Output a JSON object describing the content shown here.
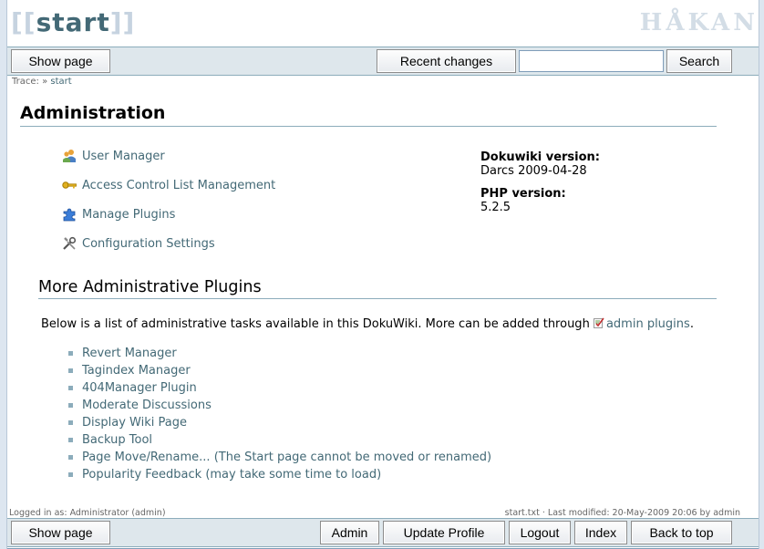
{
  "header": {
    "brand_open": "[[",
    "brand_word": "start",
    "brand_close": "]]",
    "logo": "HÅKAN"
  },
  "top_bar": {
    "show_page": "Show page",
    "recent_changes": "Recent changes",
    "search_value": "",
    "search": "Search"
  },
  "trace": {
    "label": "Trace:",
    "sep": "»",
    "current": "start"
  },
  "main": {
    "title": "Administration",
    "admin_items": [
      {
        "label": "User Manager",
        "icon": "users-icon"
      },
      {
        "label": "Access Control List Management",
        "icon": "key-icon"
      },
      {
        "label": "Manage Plugins",
        "icon": "puzzle-icon"
      },
      {
        "label": "Configuration Settings",
        "icon": "tools-icon"
      }
    ],
    "dokuwiki_version_label": "Dokuwiki version:",
    "dokuwiki_version": "Darcs 2009-04-28",
    "php_version_label": "PHP version:",
    "php_version": "5.2.5",
    "more_title": "More Administrative Plugins",
    "intro_text": "Below is a list of administrative tasks available in this DokuWiki. More can be added through",
    "intro_link": "admin plugins",
    "intro_end": ".",
    "plugins": [
      "Revert Manager",
      "Tagindex Manager",
      "404Manager Plugin",
      "Moderate Discussions",
      "Display Wiki Page",
      "Backup Tool",
      "Page Move/Rename... (The Start page cannot be moved or renamed)",
      "Popularity Feedback (may take some time to load)"
    ]
  },
  "footer_meta": {
    "logged_in": "Logged in as: Administrator (admin)",
    "modified": "start.txt · Last modified: 20-May-2009 20:06 by admin"
  },
  "bottom_bar": {
    "show_page": "Show page",
    "admin": "Admin",
    "update_profile": "Update Profile",
    "logout": "Logout",
    "index": "Index",
    "back_to_top": "Back to top"
  },
  "colors": {
    "link": "#436976",
    "bar": "#dee7ec",
    "rule": "#8cacbb"
  }
}
